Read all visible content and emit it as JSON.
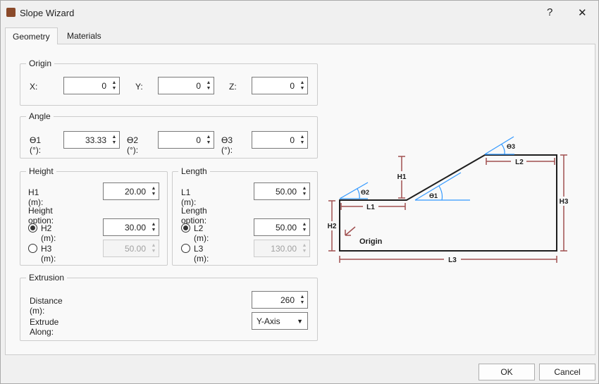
{
  "window": {
    "title": "Slope Wizard",
    "help": "?",
    "close": "✕"
  },
  "tabs": [
    {
      "label": "Geometry",
      "active": true
    },
    {
      "label": "Materials",
      "active": false
    }
  ],
  "origin": {
    "title": "Origin",
    "x_label": "X:",
    "x": "0",
    "y_label": "Y:",
    "y": "0",
    "z_label": "Z:",
    "z": "0"
  },
  "angle": {
    "title": "Angle",
    "t1_label": "ϴ1 (°):",
    "t1": "33.33",
    "t2_label": "ϴ2 (°):",
    "t2": "0",
    "t3_label": "ϴ3 (°):",
    "t3": "0"
  },
  "height": {
    "title": "Height",
    "h1_label": "H1 (m):",
    "h1": "20.00",
    "option_label": "Height option:",
    "h2_label": "H2 (m):",
    "h2": "30.00",
    "h3_label": "H3 (m):",
    "h3": "50.00",
    "selected": "H2"
  },
  "length": {
    "title": "Length",
    "l1_label": "L1 (m):",
    "l1": "50.00",
    "option_label": "Length option:",
    "l2_label": "L2 (m):",
    "l2": "50.00",
    "l3_label": "L3 (m):",
    "l3": "130.00",
    "selected": "L2"
  },
  "extrusion": {
    "title": "Extrusion",
    "distance_label": "Distance (m):",
    "distance": "260",
    "along_label": "Extrude Along:",
    "along": "Y-Axis"
  },
  "diagram": {
    "h1": "H1",
    "h2": "H2",
    "h3": "H3",
    "l1": "L1",
    "l2": "L2",
    "l3": "L3",
    "t1": "ϴ1",
    "t2": "ϴ2",
    "t3": "ϴ3",
    "origin": "Origin",
    "colors": {
      "outline": "#1e1e1e",
      "dimension": "#a05050",
      "angle": "#3399ff"
    }
  },
  "buttons": {
    "ok": "OK",
    "cancel": "Cancel"
  }
}
